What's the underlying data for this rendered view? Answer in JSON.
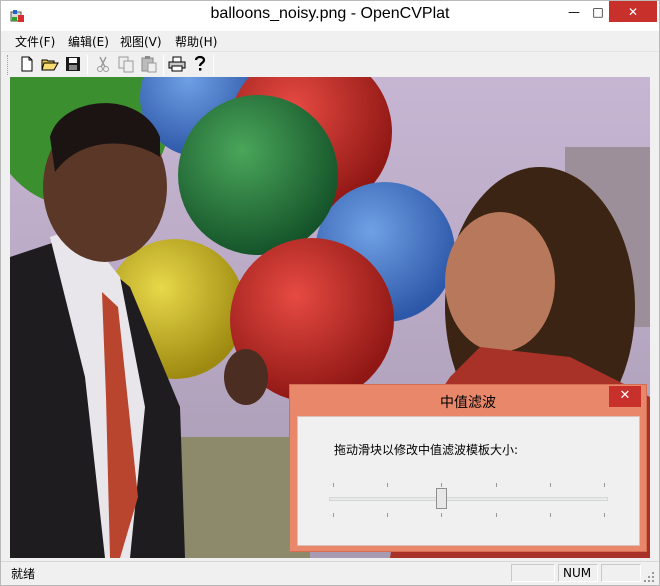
{
  "window": {
    "title": "balloons_noisy.png - OpenCVPlat",
    "controls": {
      "minimize": "—",
      "maximize": "□",
      "close": "✕"
    }
  },
  "menubar": {
    "items": [
      {
        "label": "文件(F)"
      },
      {
        "label": "编辑(E)"
      },
      {
        "label": "视图(V)"
      },
      {
        "label": "帮助(H)"
      }
    ]
  },
  "toolbar": {
    "buttons": [
      {
        "icon": "new-file-icon"
      },
      {
        "icon": "open-folder-icon"
      },
      {
        "icon": "save-icon"
      },
      {
        "icon": "cut-icon"
      },
      {
        "icon": "copy-icon"
      },
      {
        "icon": "paste-icon"
      },
      {
        "icon": "print-icon"
      },
      {
        "icon": "help-icon"
      }
    ]
  },
  "statusbar": {
    "text": "就绪",
    "caps": "",
    "num": "NUM",
    "scrl": ""
  },
  "dialog": {
    "title": "中值滤波",
    "close": "✕",
    "label": "拖动滑块以修改中值滤波模板大小:",
    "slider": {
      "min_fraction": 0,
      "value_fraction": 0.4,
      "ticks": 6
    },
    "colors": {
      "frame": "#e9876b",
      "close": "#c7302b"
    }
  },
  "colors": {
    "close_button": "#c7302b",
    "window_bg": "#f0f0f0"
  }
}
